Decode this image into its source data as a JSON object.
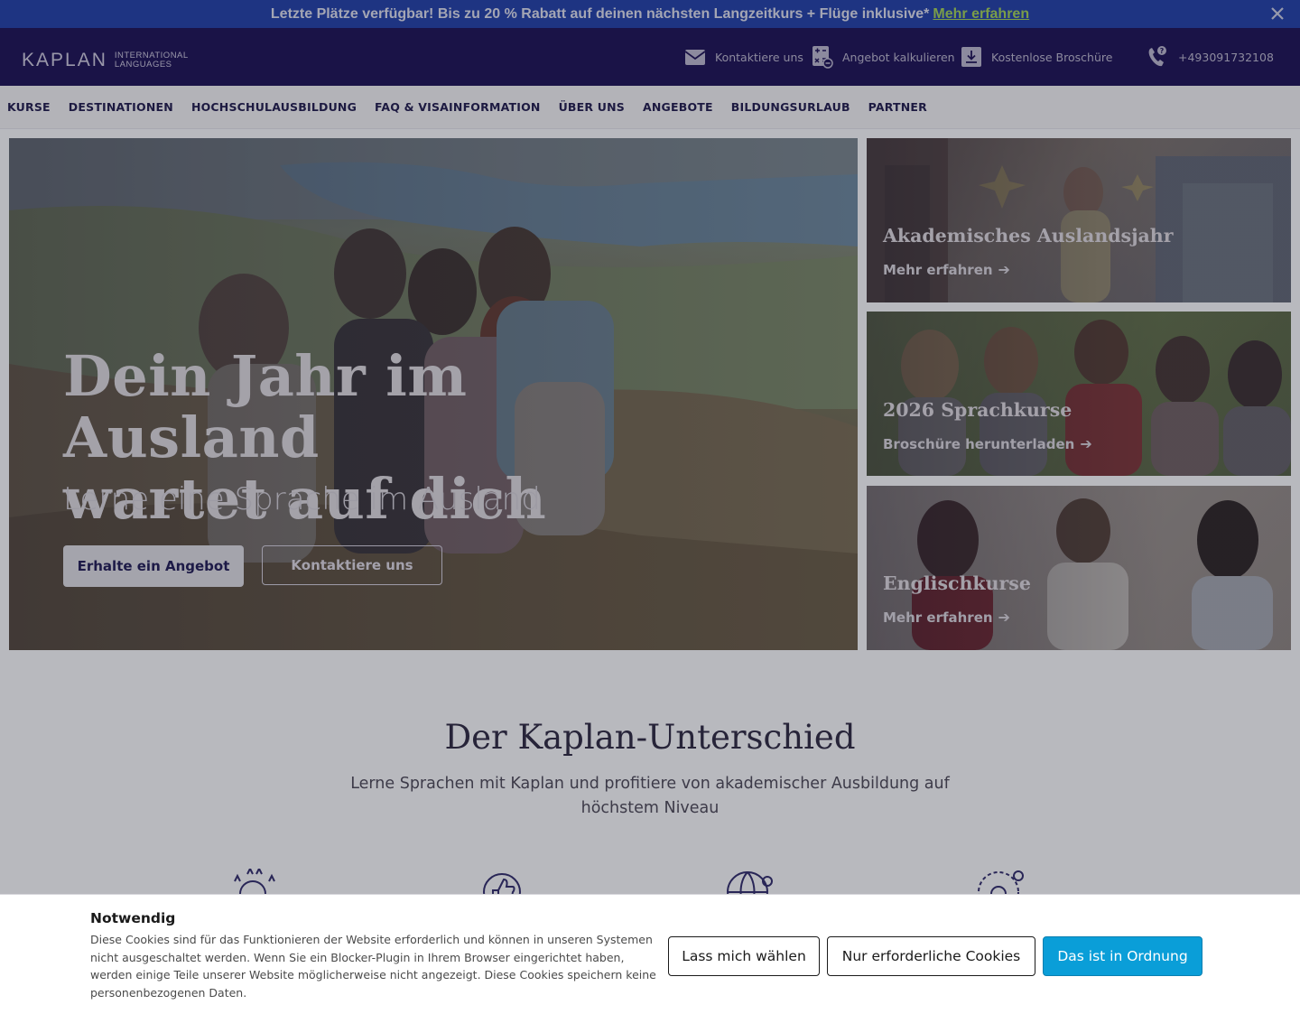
{
  "promo": {
    "text": "Letzte Plätze verfügbar! Bis zu 20 % Rabatt auf deinen nächsten Langzeitkurs + Flüge inklusive*",
    "link": "Mehr erfahren"
  },
  "header": {
    "logo_brand": "KAPLAN",
    "logo_sub_1": "INTERNATIONAL",
    "logo_sub_2": "LANGUAGES",
    "contact": "Kontaktiere uns",
    "quote": "Angebot kalkulieren",
    "brochure": "Kostenlose Broschüre",
    "phone": "+493091732108"
  },
  "nav": {
    "items": [
      "KURSE",
      "DESTINATIONEN",
      "HOCHSCHULAUSBILDUNG",
      "FAQ & VISAINFORMATION",
      "ÜBER UNS",
      "ANGEBOTE",
      "BILDUNGSURLAUB",
      "PARTNER"
    ]
  },
  "hero": {
    "title_line1": "Dein Jahr im Ausland",
    "title_line2": "wartet auf dich",
    "subtitle": "Lerne eine Sprache im Ausland",
    "primary_button": "Erhalte ein Angebot",
    "secondary_button": "Kontaktiere uns"
  },
  "cards": [
    {
      "title": "Akademisches Auslandsjahr",
      "link": "Mehr erfahren"
    },
    {
      "title": "2026 Sprachkurse",
      "link": "Broschüre herunterladen"
    },
    {
      "title": "Englischkurse",
      "link": "Mehr erfahren"
    }
  ],
  "section": {
    "title": "Der Kaplan-Unterschied",
    "subtitle": "Lerne Sprachen mit Kaplan und profitiere von akademischer Ausbildung auf höchstem Niveau"
  },
  "cookie": {
    "title": "Notwendig",
    "text": "Diese Cookies sind für das Funktionieren der Website erforderlich und können in unseren Systemen nicht ausgeschaltet werden. Wenn Sie ein Blocker-Plugin in Ihrem Browser eingerichtet haben, werden einige Teile unserer Website möglicherweise nicht angezeigt. Diese Cookies speichern keine personenbezogenen Daten.",
    "btn_choose": "Lass mich wählen",
    "btn_required": "Nur erforderliche Cookies",
    "btn_accept": "Das ist in Ordnung"
  },
  "colors": {
    "promo_bg": "#1f3da6",
    "header_bg": "#1a1054",
    "accept_button": "#0a9ed8",
    "link_green": "#9fcf55"
  }
}
